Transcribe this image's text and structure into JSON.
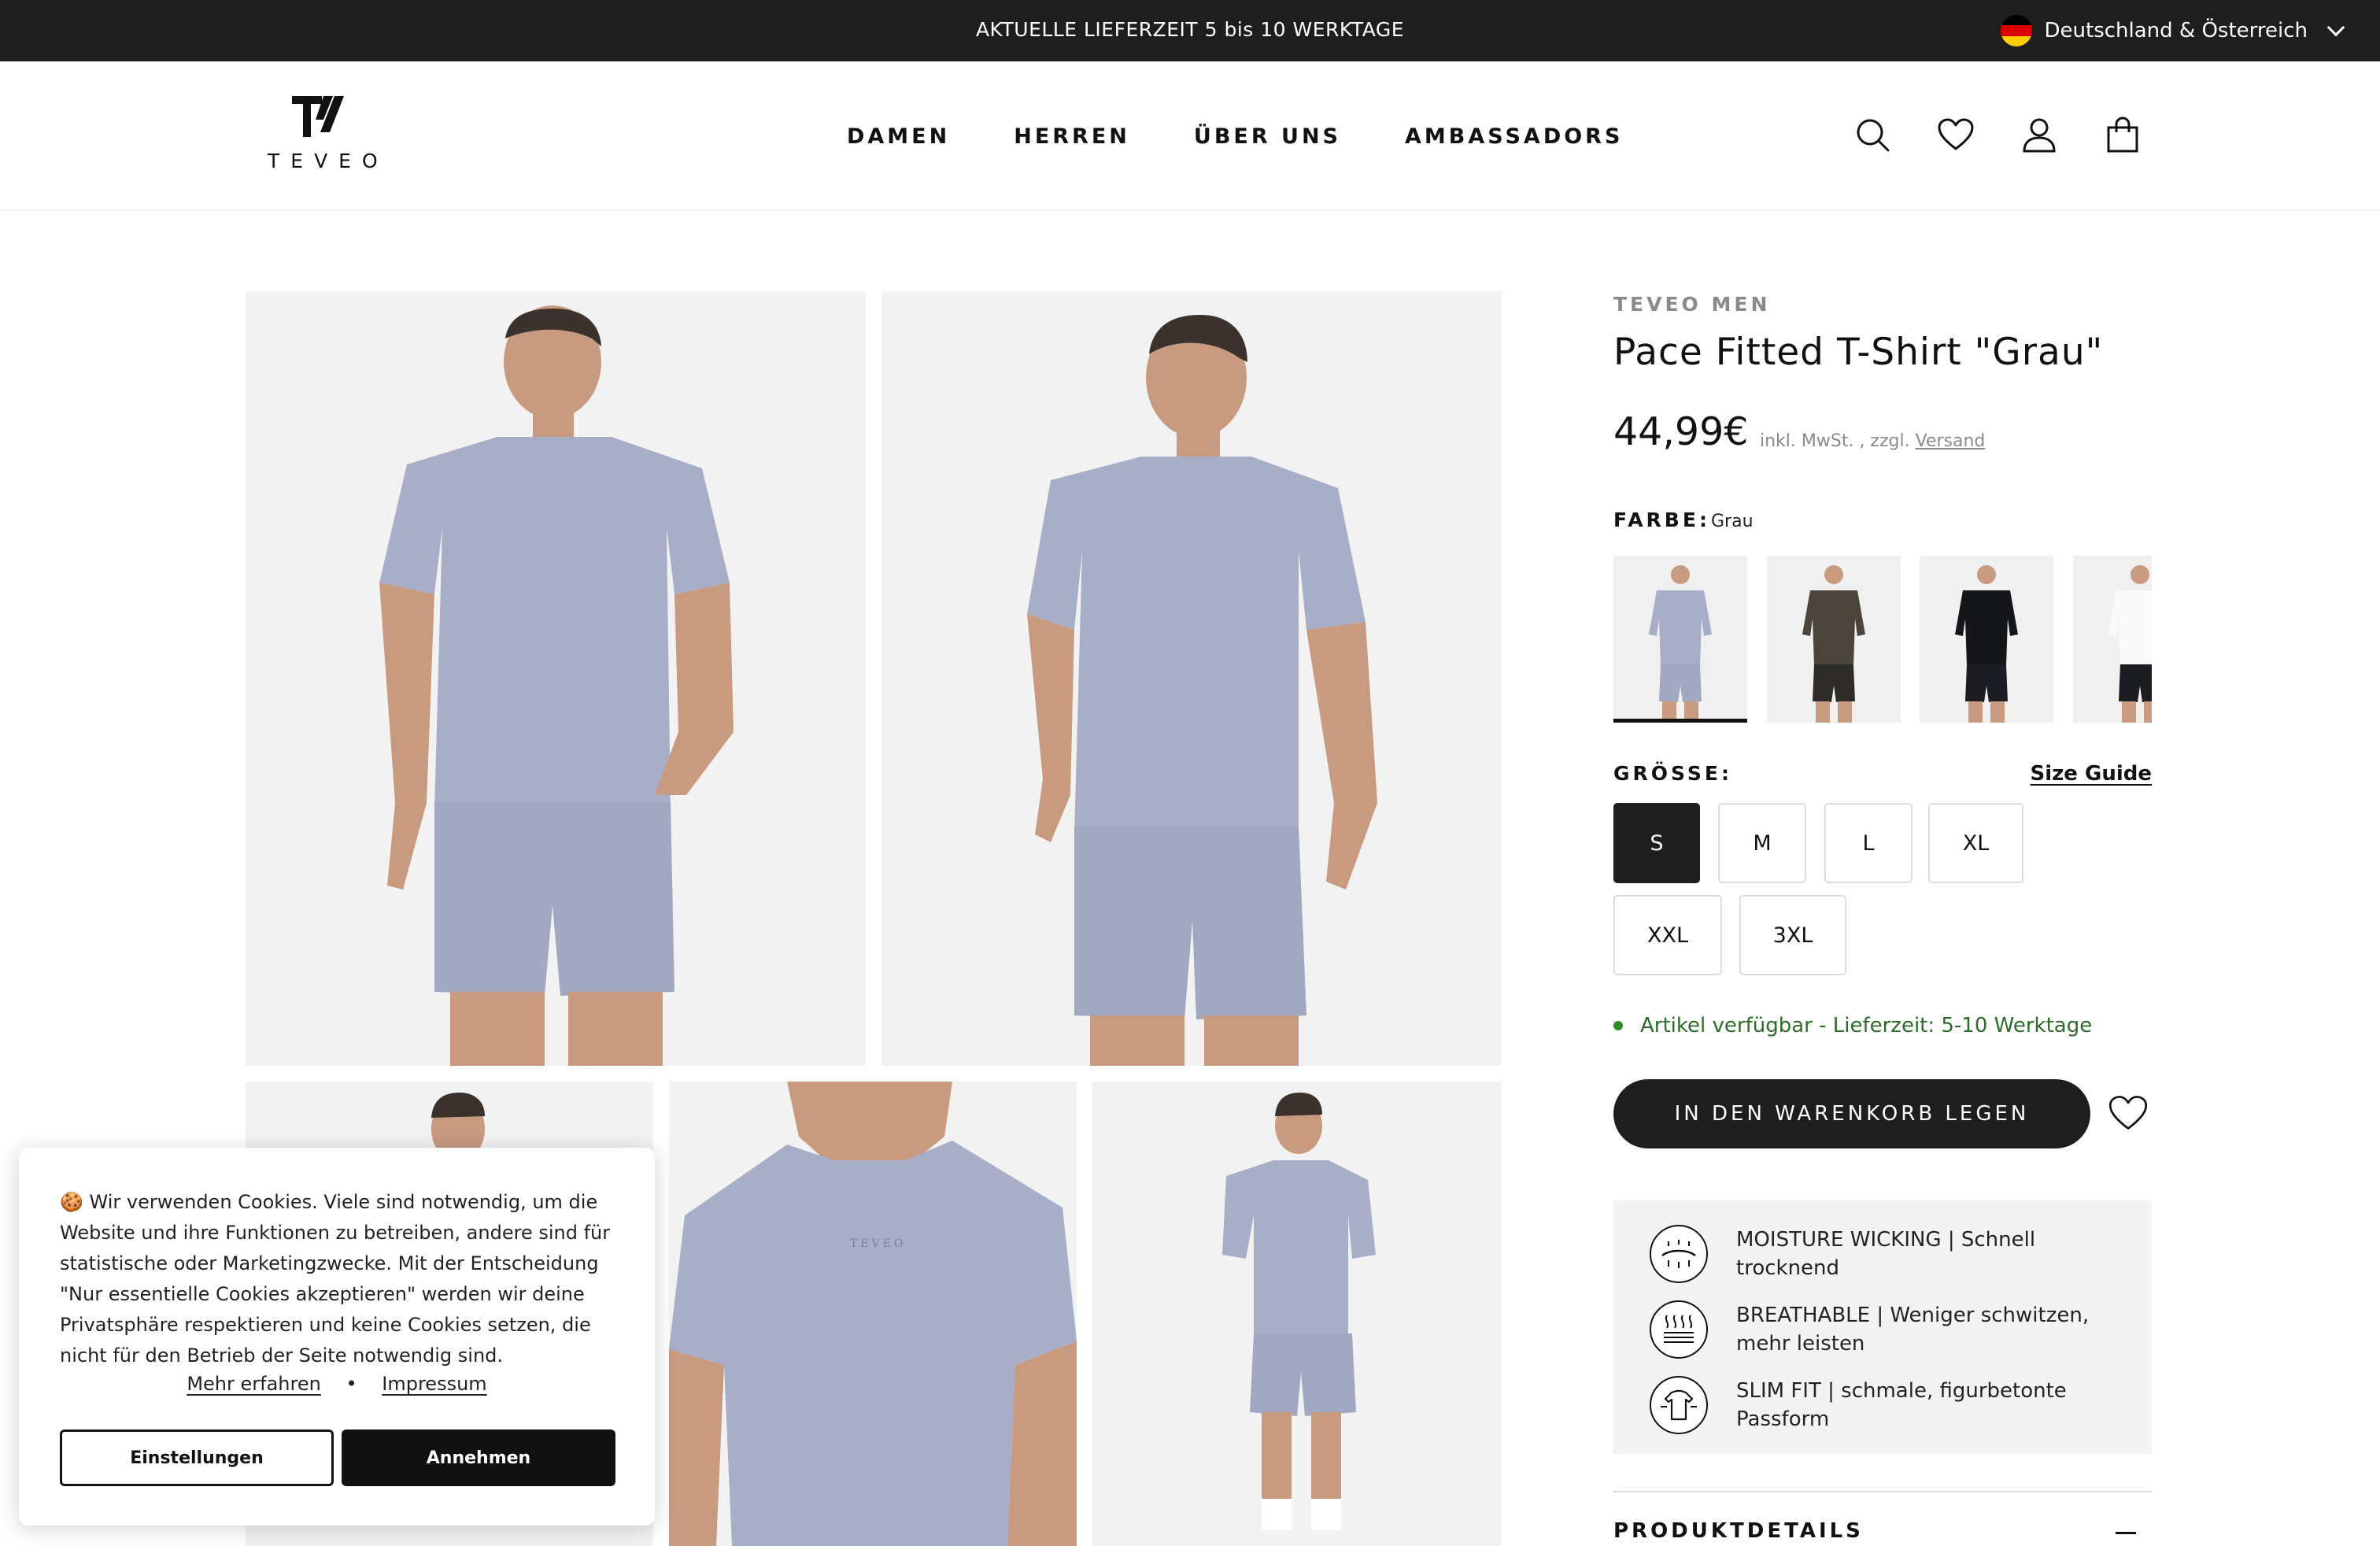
{
  "announcement": {
    "text": "AKTUELLE LIEFERZEIT 5 bis 10 WERKTAGE",
    "locale": "Deutschland & Österreich"
  },
  "header": {
    "logo_text": "TEVEO",
    "nav": [
      "DAMEN",
      "HERREN",
      "ÜBER UNS",
      "AMBASSADORS"
    ],
    "icons": [
      "search-icon",
      "heart-icon",
      "account-icon",
      "bag-icon"
    ]
  },
  "product": {
    "brand": "TEVEO MEN",
    "title": "Pace Fitted T-Shirt \"Grau\"",
    "price": "44,99€",
    "tax_note": "inkl. MwSt. , zzgl.",
    "shipping_link": "Versand",
    "color_label": "FARBE:",
    "color_value": "Grau",
    "colors": [
      "Grau",
      "Olive",
      "Schwarz",
      "Weiß"
    ],
    "size_label": "GRÖSSE:",
    "size_guide": "Size Guide",
    "sizes": [
      "S",
      "M",
      "L",
      "XL",
      "XXL",
      "3XL"
    ],
    "selected_size": "S",
    "availability": "Artikel verfügbar - Lieferzeit: 5-10 Werktage",
    "add_to_cart": "IN DEN WARENKORB LEGEN",
    "features": [
      {
        "icon": "moisture-icon",
        "text": "MOISTURE WICKING | Schnell trocknend"
      },
      {
        "icon": "breathable-icon",
        "text": "BREATHABLE | Weniger schwitzen, mehr leisten"
      },
      {
        "icon": "slim-fit-icon",
        "text": "SLIM FIT | schmale, figurbetonte Passform"
      }
    ],
    "details_label": "PRODUKTDETAILS"
  },
  "cookie": {
    "text": "Wir verwenden Cookies. Viele sind notwendig, um die Website und ihre Funktionen zu betreiben, andere sind für statistische oder Marketingzwecke. Mit der Entscheidung \"Nur essentielle Cookies akzeptieren\" werden wir deine Privatsphäre respektieren und keine Cookies setzen, die nicht für den Betrieb der Seite notwendig sind.",
    "learn_more": "Mehr erfahren",
    "imprint": "Impressum",
    "settings": "Einstellungen",
    "accept": "Annehmen"
  },
  "colors": {
    "shirt_grey": "#a9aec8",
    "dark_bar": "#1e1e1e",
    "stock_green": "#2d6b28"
  }
}
